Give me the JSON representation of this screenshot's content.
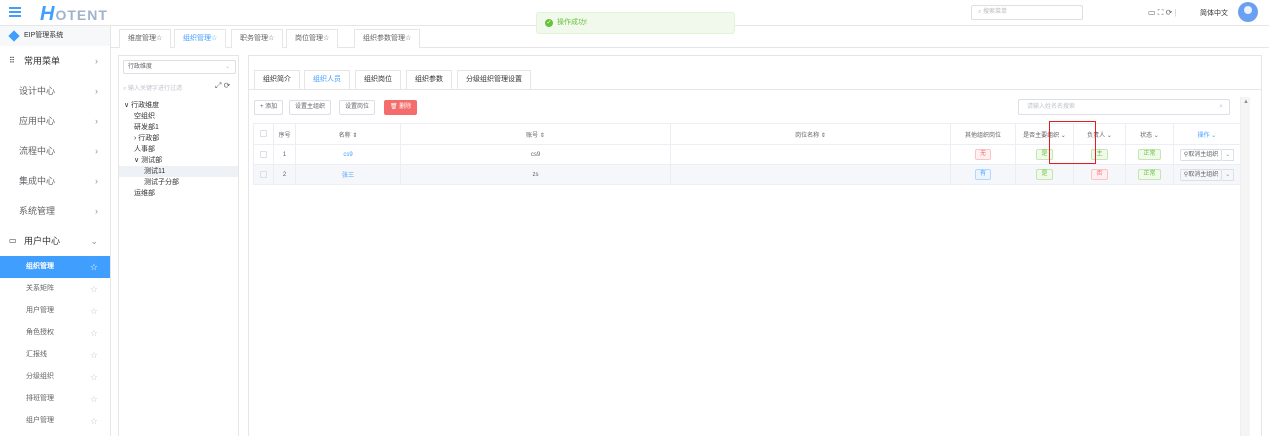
{
  "header": {
    "logo_text": "OTENT",
    "logo_mark": "H",
    "search_placeholder": "搜索菜单",
    "language": "简体中文"
  },
  "toast": {
    "message": "操作成功!"
  },
  "sidebar": {
    "system_name": "EIP管理系统",
    "groups": [
      {
        "label": "常用菜单",
        "icon": "grid-icon"
      },
      {
        "label": "设计中心"
      },
      {
        "label": "应用中心"
      },
      {
        "label": "流程中心"
      },
      {
        "label": "集成中心"
      },
      {
        "label": "系统管理"
      },
      {
        "label": "用户中心",
        "icon": "monitor-icon",
        "expanded": true
      }
    ],
    "sub_items": [
      "组织管理",
      "关系矩阵",
      "用户管理",
      "角色授权",
      "汇报线",
      "分级组织",
      "排班管理",
      "组户管理"
    ],
    "active_sub": "组织管理"
  },
  "page_tabs": [
    "维度管理☆",
    "组织管理☆",
    "职务管理☆",
    "岗位管理☆",
    "组织参数管理☆"
  ],
  "active_page_tab": "组织管理☆",
  "tree_panel": {
    "dimension_select": "行政维度",
    "filter_placeholder": "输入关键字进行过滤",
    "nodes": [
      {
        "label": "行政维度",
        "prefix": "∨ ",
        "indent": 0
      },
      {
        "label": "空组织",
        "prefix": "",
        "indent": 1
      },
      {
        "label": "研发部1",
        "prefix": "",
        "indent": 1
      },
      {
        "label": "行政部",
        "prefix": "› ",
        "indent": 1
      },
      {
        "label": "人事部",
        "prefix": "",
        "indent": 1
      },
      {
        "label": "测试部",
        "prefix": "∨ ",
        "indent": 1
      },
      {
        "label": "测试11",
        "prefix": "",
        "indent": 2,
        "selected": true
      },
      {
        "label": "测试子分部",
        "prefix": "",
        "indent": 2
      },
      {
        "label": "运维部",
        "prefix": "",
        "indent": 1
      }
    ]
  },
  "content_tabs": [
    "组织简介",
    "组织人员",
    "组织岗位",
    "组织参数",
    "分级组织管理设置"
  ],
  "active_content_tab": "组织人员",
  "toolbar": {
    "add": "+ 添加",
    "set_main_org": "设置主组织",
    "set_post": "设置岗位",
    "delete": "删除",
    "search_placeholder": "请输入姓名名搜索"
  },
  "table": {
    "columns": [
      "序号",
      "名称 ⇕",
      "账号 ⇕",
      "岗位名称 ⇕",
      "其他组织岗位",
      "是否主要组织 ⌄",
      "负责人 ⌄",
      "状态 ⌄",
      "操作 ⌄"
    ],
    "rows": [
      {
        "index": "1",
        "name": "cs9",
        "account": "cs9",
        "post": "",
        "other": "无",
        "is_main": "是",
        "leader": "主",
        "status": "正常",
        "op": "⚲取消主组织"
      },
      {
        "index": "2",
        "name": "张三",
        "account": "zs",
        "post": "",
        "other": "有",
        "is_main": "是",
        "leader": "否",
        "status": "正常",
        "op": "⚲取消主组织"
      }
    ]
  },
  "colors": {
    "primary": "#409eff",
    "danger": "#f56c6c",
    "success": "#67c23a"
  }
}
